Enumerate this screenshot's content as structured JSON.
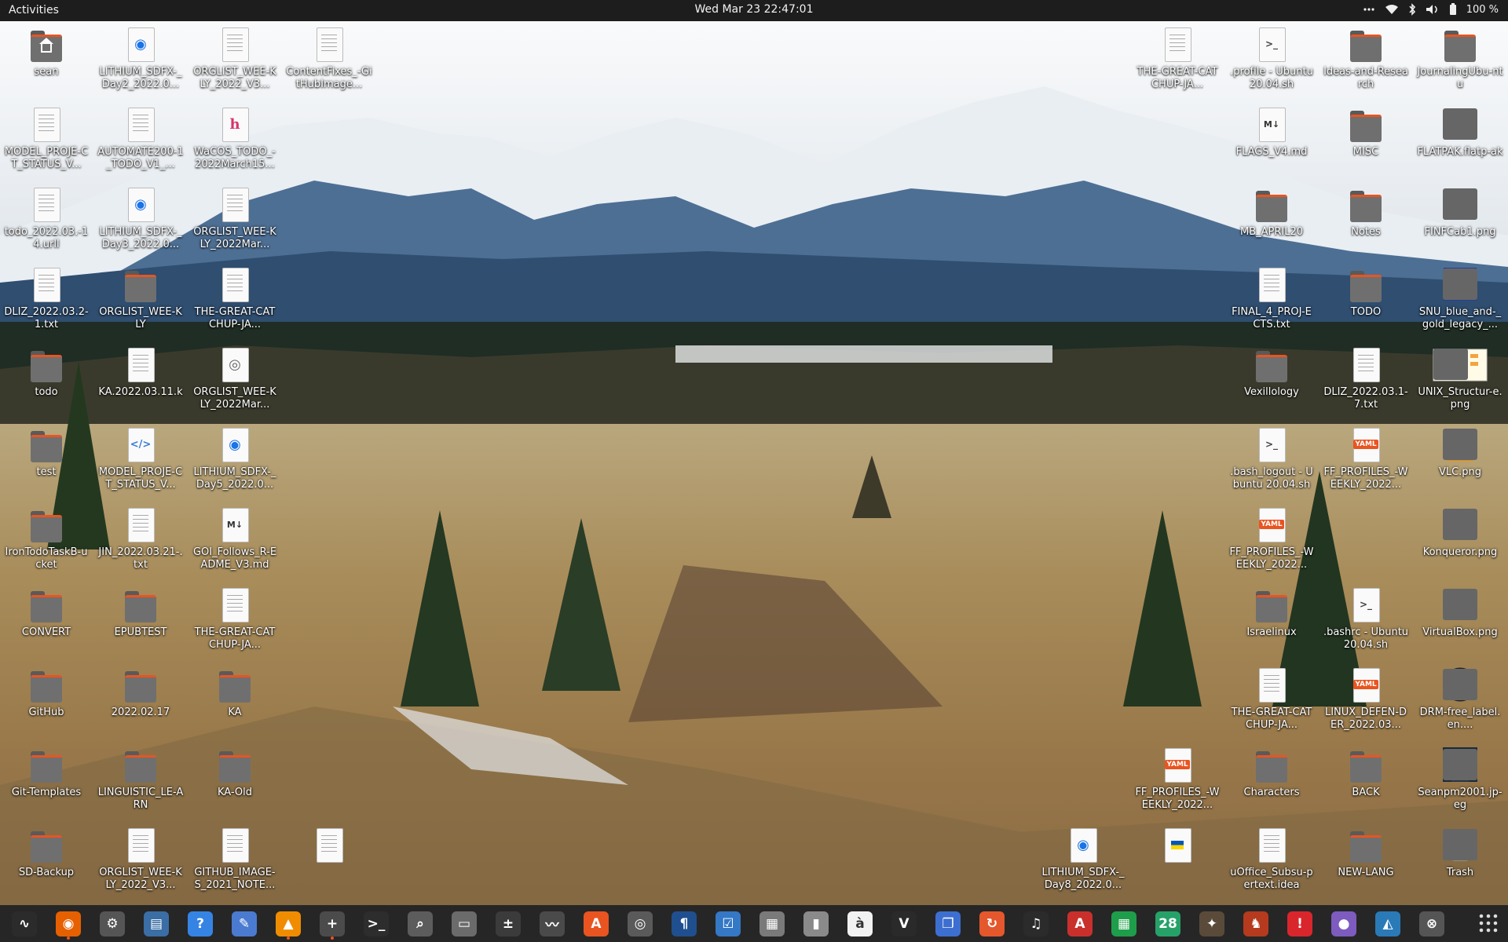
{
  "topbar": {
    "activities": "Activities",
    "clock": "Wed Mar 23  22:47:01",
    "battery": "100 %",
    "tray_icons": [
      "menu-dots-icon",
      "wifi-icon",
      "bluetooth-icon",
      "volume-icon",
      "battery-icon"
    ]
  },
  "desktop": {
    "icons": [
      {
        "label": "sean",
        "type": "home"
      },
      {
        "label": "LITHIUM_SDFX-_Day2_2022.0...",
        "type": "web"
      },
      {
        "label": "ORGLIST_WEE-KLY_2022_V3...",
        "type": "doc"
      },
      {
        "label": "ContentFixes_-GitHubImage...",
        "type": "doc"
      },
      {
        "label": "MODEL_PROJE-CT_STATUS_V...",
        "type": "doc"
      },
      {
        "label": "AUTOMATE200-1_TODO_V1_...",
        "type": "doc"
      },
      {
        "label": "WaCOS_TODO_-2022March15...",
        "type": "h"
      },
      {
        "label": "todo_2022.03.-14.urll",
        "type": "doc"
      },
      {
        "label": "LITHIUM_SDFX-_Day3_2022.0...",
        "type": "web"
      },
      {
        "label": "ORGLIST_WEE-KLY_2022Mar...",
        "type": "doc"
      },
      {
        "label": "DLIZ_2022.03.2-1.txt",
        "type": "doc"
      },
      {
        "label": "ORGLIST_WEE-KLY",
        "type": "folder"
      },
      {
        "label": "THE-GREAT-CATCHUP-JA...",
        "type": "doc"
      },
      {
        "label": "todo",
        "type": "folder"
      },
      {
        "label": "KA.2022.03.11.k",
        "type": "doc"
      },
      {
        "label": "ORGLIST_WEE-KLY_2022Mar...",
        "type": "disc"
      },
      {
        "label": "test",
        "type": "folder"
      },
      {
        "label": "MODEL_PROJE-CT_STATUS_V...",
        "type": "code"
      },
      {
        "label": "LITHIUM_SDFX-_Day5_2022.0...",
        "type": "web"
      },
      {
        "label": "IronTodoTaskB-ucket",
        "type": "folder"
      },
      {
        "label": "JIN_2022.03.21-.txt",
        "type": "doc"
      },
      {
        "label": "GOI_Follows_R-EADME_V3.md",
        "type": "md"
      },
      {
        "label": "CONVERT",
        "type": "folder"
      },
      {
        "label": "EPUBTEST",
        "type": "folder"
      },
      {
        "label": "THE-GREAT-CATCHUP-JA...",
        "type": "doc"
      },
      {
        "label": "GitHub",
        "type": "folder"
      },
      {
        "label": "2022.02.17",
        "type": "folder"
      },
      {
        "label": "KA",
        "type": "folder"
      },
      {
        "label": "Git-Templates",
        "type": "folder"
      },
      {
        "label": "LINGUISTIC_LE-ARN",
        "type": "folder"
      },
      {
        "label": "KA-Old",
        "type": "folder"
      },
      {
        "label": "SD-Backup",
        "type": "folder"
      },
      {
        "label": "ORGLIST_WEE-KLY_2022_V3...",
        "type": "doc"
      },
      {
        "label": "GITHUB_IMAGE-S_2021_NOTE...",
        "type": "doc"
      },
      {
        "label": "",
        "type": "doc"
      },
      {
        "label": "THE-GREAT-CATCHUP-JA...",
        "type": "doc"
      },
      {
        "label": ".profile - Ubuntu 20.04.sh",
        "type": "term"
      },
      {
        "label": "Ideas-and-Research",
        "type": "folder"
      },
      {
        "label": "JournalingUbu-ntu",
        "type": "folder"
      },
      {
        "label": "FLAGS_V4.md",
        "type": "md"
      },
      {
        "label": "MISC",
        "type": "folder"
      },
      {
        "label": "FLATPAK.flatp-ak",
        "type": "flatpak"
      },
      {
        "label": "MB_APRIL20",
        "type": "folder"
      },
      {
        "label": "Notes",
        "type": "folder"
      },
      {
        "label": "FINFCab1.png",
        "type": "cabinet"
      },
      {
        "label": "FINAL_4_PROJ-ECTS.txt",
        "type": "doc"
      },
      {
        "label": "TODO",
        "type": "folder"
      },
      {
        "label": "SNU_blue_and-_gold_legacy_...",
        "type": "snu"
      },
      {
        "label": "Vexillology",
        "type": "folder"
      },
      {
        "label": "DLIZ_2022.03.1-7.txt",
        "type": "doc"
      },
      {
        "label": "UNIX_Structur-e.png",
        "type": "unix"
      },
      {
        "label": ".bash_logout - Ubuntu 20.04.sh",
        "type": "term"
      },
      {
        "label": "FF_PROFILES_-WEEKLY_2022...",
        "type": "yaml"
      },
      {
        "label": "VLC.png",
        "type": "vlc"
      },
      {
        "label": "FF_PROFILES_-WEEKLY_2022...",
        "type": "yaml"
      },
      {
        "label": "Konqueror.png",
        "type": "konq"
      },
      {
        "label": "Israelinux",
        "type": "folder"
      },
      {
        "label": ".bashrc - Ubuntu 20.04.sh",
        "type": "term"
      },
      {
        "label": "VirtualBox.png",
        "type": "vbox"
      },
      {
        "label": "THE-GREAT-CATCHUP-JA...",
        "type": "doc"
      },
      {
        "label": "LINUX_DEFEN-DER_2022.03...",
        "type": "yaml"
      },
      {
        "label": "DRM-free_label.en....",
        "type": "drm"
      },
      {
        "label": "FF_PROFILES_-WEEKLY_2022...",
        "type": "yaml"
      },
      {
        "label": "Characters",
        "type": "folder"
      },
      {
        "label": "BACK",
        "type": "folder"
      },
      {
        "label": "Seanpm2001.jp-eg",
        "type": "photo"
      },
      {
        "label": "LITHIUM_SDFX-_Day8_2022.0...",
        "type": "web"
      },
      {
        "label": "",
        "type": "ukraine"
      },
      {
        "label": "uOffice_Subsu-pertext.idea",
        "type": "doc"
      },
      {
        "label": "NEW-LANG",
        "type": "folder"
      },
      {
        "label": "Trash",
        "type": "trash"
      }
    ]
  },
  "dock": {
    "apps": [
      {
        "name": "system-monitor",
        "color": "#2b2b2b",
        "glyph": "∿"
      },
      {
        "name": "firefox",
        "color": "#e66000",
        "glyph": "◉"
      },
      {
        "name": "settings",
        "color": "#555555",
        "glyph": "⚙"
      },
      {
        "name": "text-document",
        "color": "#3a6ea5",
        "glyph": "▤"
      },
      {
        "name": "help",
        "color": "#3584e4",
        "glyph": "?"
      },
      {
        "name": "text-editor",
        "color": "#4a7bd0",
        "glyph": "✎"
      },
      {
        "name": "vlc",
        "color": "#f08c00",
        "glyph": "▲"
      },
      {
        "name": "file-manager-add",
        "color": "#4b4b4b",
        "glyph": "+"
      },
      {
        "name": "terminal",
        "color": "#2d2d2d",
        "glyph": ">_"
      },
      {
        "name": "image-viewer",
        "color": "#5c5c5c",
        "glyph": "⌕"
      },
      {
        "name": "files",
        "color": "#6b6b6b",
        "glyph": "▭"
      },
      {
        "name": "calculator",
        "color": "#3b3b3b",
        "glyph": "±"
      },
      {
        "name": "system-graph",
        "color": "#4a4a4a",
        "glyph": "〰"
      },
      {
        "name": "software",
        "color": "#e95420",
        "glyph": "A"
      },
      {
        "name": "disk-tool",
        "color": "#5a5a5a",
        "glyph": "◎"
      },
      {
        "name": "reader",
        "color": "#1f4f8f",
        "glyph": "¶"
      },
      {
        "name": "tasks",
        "color": "#3478c6",
        "glyph": "☑"
      },
      {
        "name": "clipboard",
        "color": "#7a7a7a",
        "glyph": "▦"
      },
      {
        "name": "archive",
        "color": "#8a8a8a",
        "glyph": "▮"
      },
      {
        "name": "character-map",
        "color": "#f2f2f2",
        "glyph": "à"
      },
      {
        "name": "vim",
        "color": "#2a2a2a",
        "glyph": "V"
      },
      {
        "name": "workspaces",
        "color": "#3d6fd1",
        "glyph": "❐"
      },
      {
        "name": "updater",
        "color": "#e5572d",
        "glyph": "↻"
      },
      {
        "name": "music",
        "color": "#2b2b2b",
        "glyph": "♫"
      },
      {
        "name": "pdf-viewer",
        "color": "#c9302c",
        "glyph": "A"
      },
      {
        "name": "spreadsheet",
        "color": "#1e9e4a",
        "glyph": "▦"
      },
      {
        "name": "calendar",
        "color": "#26a269",
        "glyph": "28"
      },
      {
        "name": "gimp",
        "color": "#5a4a3a",
        "glyph": "✦"
      },
      {
        "name": "game",
        "color": "#b53a1e",
        "glyph": "♞"
      },
      {
        "name": "alert",
        "color": "#d9262c",
        "glyph": "!"
      },
      {
        "name": "media",
        "color": "#7d5bbf",
        "glyph": "●"
      },
      {
        "name": "chart-app",
        "color": "#2a7ab8",
        "glyph": "◭"
      },
      {
        "name": "drm-tool",
        "color": "#555555",
        "glyph": "⊗"
      }
    ],
    "show_apps": "show-apps-icon"
  }
}
